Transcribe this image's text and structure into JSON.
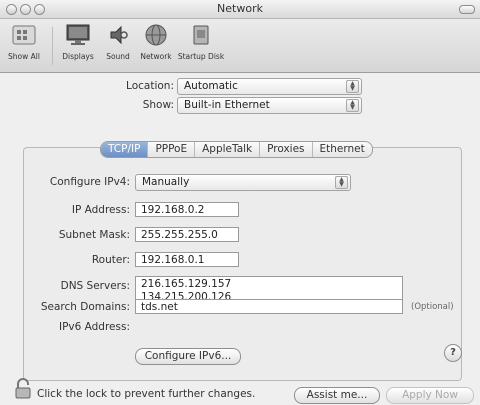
{
  "window": {
    "title": "Network"
  },
  "toolbar": {
    "items": [
      {
        "label": "Show All",
        "icon": "grid-icon"
      },
      {
        "label": "Displays",
        "icon": "display-icon"
      },
      {
        "label": "Sound",
        "icon": "speaker-icon"
      },
      {
        "label": "Network",
        "icon": "network-globe-icon"
      },
      {
        "label": "Startup Disk",
        "icon": "disk-icon"
      }
    ]
  },
  "location": {
    "label": "Location:",
    "value": "Automatic"
  },
  "show": {
    "label": "Show:",
    "value": "Built-in Ethernet"
  },
  "tabs": [
    "TCP/IP",
    "PPPoE",
    "AppleTalk",
    "Proxies",
    "Ethernet"
  ],
  "selected_tab": "TCP/IP",
  "configure_ipv4": {
    "label": "Configure IPv4:",
    "value": "Manually"
  },
  "ip_address": {
    "label": "IP Address:",
    "value": "192.168.0.2"
  },
  "subnet_mask": {
    "label": "Subnet Mask:",
    "value": "255.255.255.0"
  },
  "router": {
    "label": "Router:",
    "value": "192.168.0.1"
  },
  "dns_servers": {
    "label": "DNS Servers:",
    "line1": "216.165.129.157",
    "line2": "134.215.200.126"
  },
  "search_domains": {
    "label": "Search Domains:",
    "value": "tds.net",
    "hint": "(Optional)"
  },
  "ipv6_address": {
    "label": "IPv6 Address:"
  },
  "configure_ipv6_button": "Configure IPv6...",
  "help_label": "?",
  "footer": {
    "lock_text": "Click the lock to prevent further changes.",
    "assist_button": "Assist me...",
    "apply_button": "Apply Now"
  }
}
